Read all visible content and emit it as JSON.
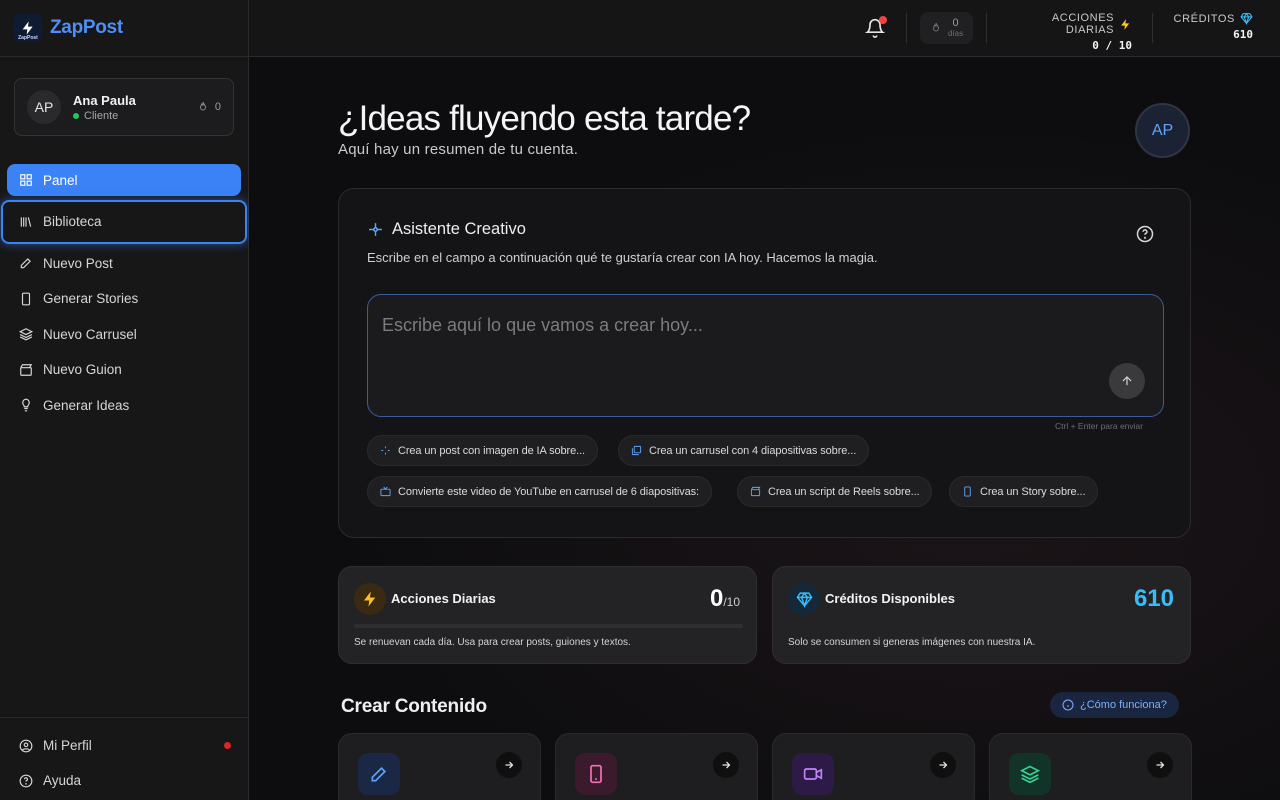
{
  "brand": {
    "name": "ZapPost",
    "logo_caption": "ZapPost"
  },
  "user": {
    "initials": "AP",
    "name": "Ana Paula",
    "role": "Cliente",
    "streak": "0"
  },
  "nav": {
    "items": [
      {
        "label": "Panel",
        "icon": "grid-icon"
      },
      {
        "label": "Biblioteca",
        "icon": "library-icon"
      },
      {
        "label": "Nuevo Post",
        "icon": "pencil-icon"
      },
      {
        "label": "Generar Stories",
        "icon": "phone-icon"
      },
      {
        "label": "Nuevo Carrusel",
        "icon": "layers-icon"
      },
      {
        "label": "Nuevo Guion",
        "icon": "clapper-icon"
      },
      {
        "label": "Generar Ideas",
        "icon": "lightbulb-icon"
      }
    ],
    "bottom": [
      {
        "label": "Mi Perfil",
        "icon": "user-icon"
      },
      {
        "label": "Ayuda",
        "icon": "help-icon"
      }
    ]
  },
  "topbar": {
    "streak_value": "0",
    "streak_unit": "días",
    "daily_actions_label": "ACCIONES DIARIAS",
    "daily_actions_value": "0 / 10",
    "credits_label": "CRÉDITOS",
    "credits_value": "610"
  },
  "main": {
    "greeting": "¿Ideas fluyendo esta tarde?",
    "subtitle": "Aquí hay un resumen de tu cuenta.",
    "avatar_initials": "AP"
  },
  "assistant": {
    "title": "Asistente Creativo",
    "description": "Escribe en el campo a continuación qué te gustaría crear con IA hoy. Hacemos la magia.",
    "placeholder": "Escribe aquí lo que vamos a crear hoy...",
    "hint": "Ctrl + Enter para enviar",
    "chips": [
      {
        "label": "Crea un post con imagen de IA sobre...",
        "icon": "sparkle-icon"
      },
      {
        "label": "Crea un carrusel con 4 diapositivas sobre...",
        "icon": "images-icon"
      },
      {
        "label": "Convierte este video de YouTube en carrusel de 6 diapositivas:",
        "icon": "tv-icon"
      },
      {
        "label": "Crea un script de Reels sobre...",
        "icon": "clapper-icon"
      },
      {
        "label": "Crea un Story sobre...",
        "icon": "phone-icon"
      }
    ]
  },
  "stats": {
    "actions": {
      "title": "Acciones Diarias",
      "value": "0",
      "max": "/10",
      "desc": "Se renuevan cada día. Usa para crear posts, guiones y textos.",
      "progress": 0
    },
    "credits": {
      "title": "Créditos Disponibles",
      "value": "610",
      "desc": "Solo se consumen si generas imágenes con nuestra IA."
    }
  },
  "create": {
    "title": "Crear Contenido",
    "how_label": "¿Cómo funciona?",
    "cards": [
      {
        "icon": "pencil-icon",
        "color": "#3b82f6"
      },
      {
        "icon": "phone-icon",
        "color": "#ec4899"
      },
      {
        "icon": "video-icon",
        "color": "#a855f7"
      },
      {
        "icon": "layers-icon",
        "color": "#10b981"
      }
    ]
  },
  "colors": {
    "accent": "#3b82f6",
    "credits": "#38bdf8",
    "bolt": "#facc15"
  }
}
